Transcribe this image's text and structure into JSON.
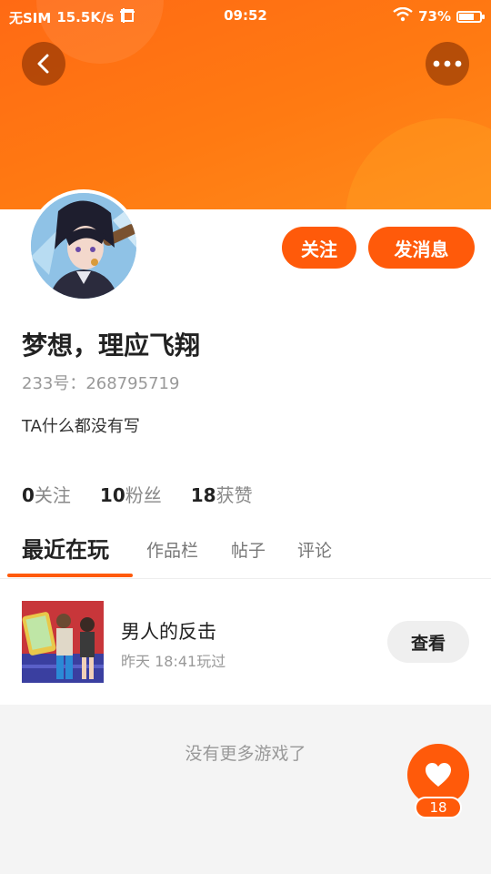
{
  "status_bar": {
    "carrier": "无SIM",
    "speed": "15.5K/s",
    "time": "09:52",
    "battery": "73%",
    "battery_level": 0.73
  },
  "header": {
    "back_icon": "chevron-left-icon",
    "more_icon": "more-dots-icon",
    "accent_color": "#ff6a14"
  },
  "profile": {
    "follow_label": "关注",
    "message_label": "发消息",
    "name": "梦想，理应飞翔",
    "id_line": "233号：268795719",
    "bio": "TA什么都没有写",
    "stats": [
      {
        "num": "0",
        "label": "关注"
      },
      {
        "num": "10",
        "label": "粉丝"
      },
      {
        "num": "18",
        "label": "获赞"
      }
    ]
  },
  "tabs": [
    "最近在玩",
    "作品栏",
    "帖子",
    "评论"
  ],
  "recent_game": {
    "title": "男人的反击",
    "subtitle": "昨天 18:41玩过",
    "view_label": "查看"
  },
  "footer": {
    "no_more": "没有更多游戏了",
    "like_count": "18",
    "like_icon": "heart-icon"
  }
}
